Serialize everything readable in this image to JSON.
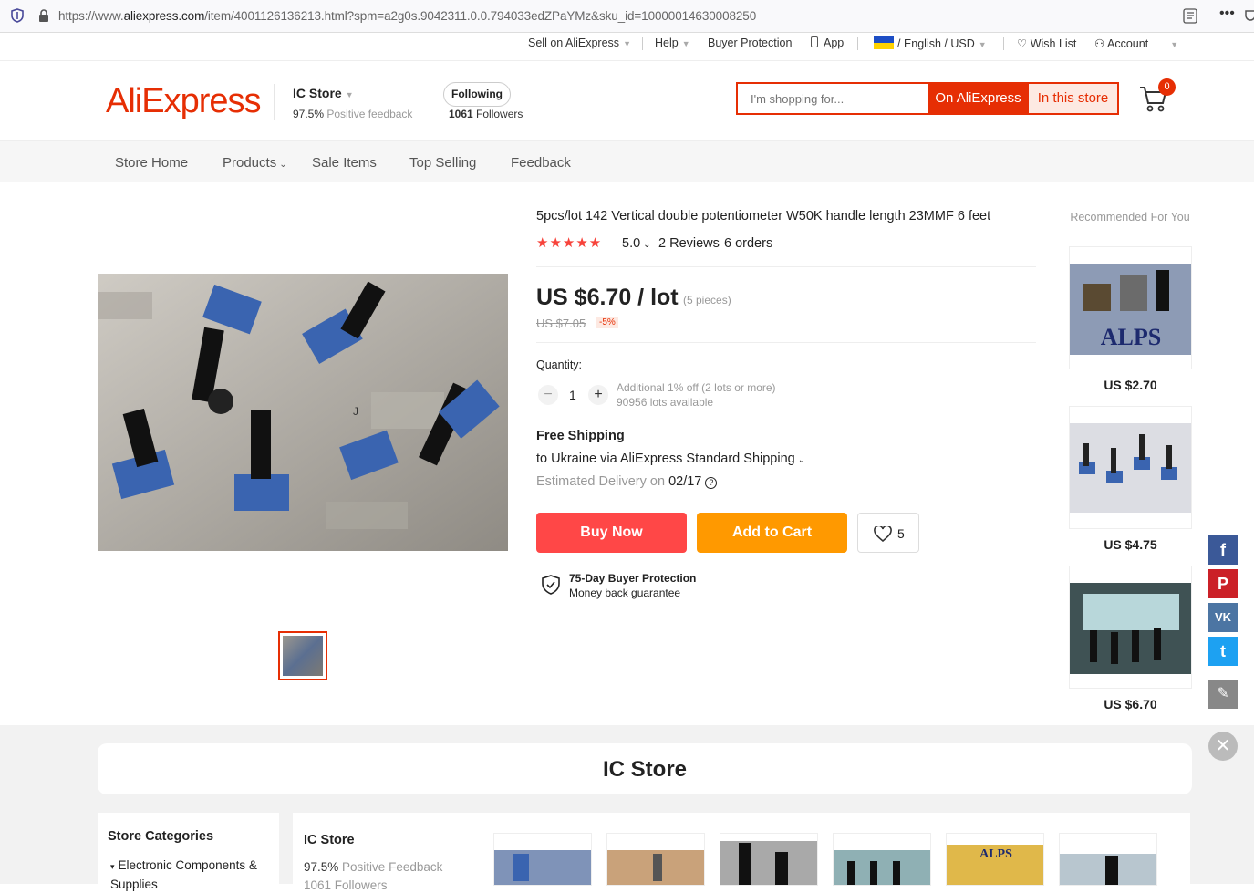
{
  "browser": {
    "url_prefix": "https://www.",
    "url_domain": "aliexpress.com",
    "url_rest": "/item/4001126136213.html?spm=a2g0s.9042311.0.0.794033edZPaYMz&sku_id=10000014630008250"
  },
  "topnav": {
    "sell": "Sell on AliExpress",
    "help": "Help",
    "buyer_protection": "Buyer Protection",
    "app": "App",
    "lang": "/ English /  USD",
    "wishlist": "Wish List",
    "account": "Account"
  },
  "header": {
    "logo": "AliExpress",
    "store_name": "IC Store",
    "feedback_value": "97.5%",
    "feedback_label": "Positive feedback",
    "follow_button": "Following",
    "followers_count": "1061",
    "followers_label": "Followers",
    "search_placeholder": "I'm shopping for...",
    "search_on_ae": "On AliExpress",
    "search_in_store": "In this store",
    "cart_count": "0"
  },
  "storenav": [
    "Store Home",
    "Products",
    "Sale Items",
    "Top Selling",
    "Feedback"
  ],
  "product": {
    "title": "5pcs/lot 142 Vertical double potentiometer W50K handle length 23MMF 6 feet",
    "rating": 5.0,
    "rating_text": "5.0",
    "reviews": "2 Reviews",
    "orders": "6 orders",
    "price": "US $6.70 / lot",
    "pieces": "(5 pieces)",
    "old_price": "US $7.05",
    "discount": "-5%",
    "quantity_label": "Quantity:",
    "quantity": "1",
    "qty_info1": "Additional 1% off (2 lots or more)",
    "qty_info2": "90956 lots available",
    "shipping_title": "Free Shipping",
    "shipping_to": "to Ukraine via AliExpress Standard Shipping",
    "delivery_label": "Estimated Delivery on",
    "delivery_date": "02/17",
    "buy_now": "Buy Now",
    "add_to_cart": "Add to Cart",
    "wish_count": "5",
    "protection_title": "75-Day Buyer Protection",
    "protection_sub": "Money back guarantee"
  },
  "recommended": {
    "title": "Recommended For You",
    "items": [
      {
        "price": "US $2.70",
        "label": "ALPS"
      },
      {
        "price": "US $4.75"
      },
      {
        "price": "US $6.70"
      }
    ]
  },
  "lower": {
    "banner": "IC Store",
    "categories_title": "Store Categories",
    "category_item": "Electronic Components & Supplies",
    "store_name": "IC Store",
    "feedback_value": "97.5%",
    "feedback_label": "Positive Feedback",
    "followers": "1061 Followers"
  },
  "colors": {
    "brand": "#e62e04",
    "buy": "#ff4747",
    "cart": "#ff9900",
    "star": "#f7433b"
  }
}
